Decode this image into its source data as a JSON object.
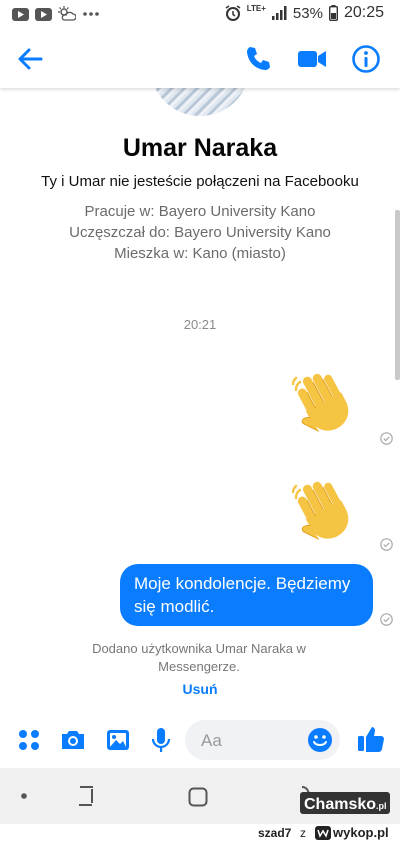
{
  "status_bar": {
    "battery": "53%",
    "time": "20:25",
    "network": "LTE+",
    "left_icons": [
      "youtube-icon",
      "youtube-icon",
      "weather-icon",
      "more-dots-icon"
    ],
    "right_icons": [
      "alarm-icon",
      "signal-icon",
      "battery-icon"
    ]
  },
  "app_bar": {
    "icons": [
      "back-arrow-icon",
      "phone-icon",
      "video-icon",
      "info-icon"
    ],
    "accent": "#0a7cff"
  },
  "profile": {
    "name": "Umar Naraka",
    "relation": "Ty i Umar nie jesteście połączeni na Facebooku",
    "work": "Pracuje w: Bayero University Kano",
    "school": "Uczęszczał do: Bayero University Kano",
    "lives": "Mieszka w: Kano (miasto)"
  },
  "conversation": {
    "timestamp": "20:21",
    "messages": [
      {
        "type": "emoji",
        "content": "waving-hand"
      },
      {
        "type": "emoji",
        "content": "waving-hand"
      },
      {
        "type": "text",
        "content": "Moje kondolencje. Będziemy się modlić."
      }
    ],
    "system_notice": "Dodano użytkownika Umar Naraka w Messengerze.",
    "system_action": "Usuń"
  },
  "composer": {
    "placeholder": "Aa",
    "icons": [
      "apps-grid-icon",
      "camera-icon",
      "gallery-icon",
      "microphone-icon",
      "emoji-icon",
      "thumbs-up-icon"
    ]
  },
  "footer": {
    "user": "szad7",
    "separator": "z",
    "site": "wykop.pl",
    "watermark": "Chamsko.pl"
  },
  "colors": {
    "messenger_blue": "#0a7cff",
    "emoji_yellow": "#f6c443"
  }
}
